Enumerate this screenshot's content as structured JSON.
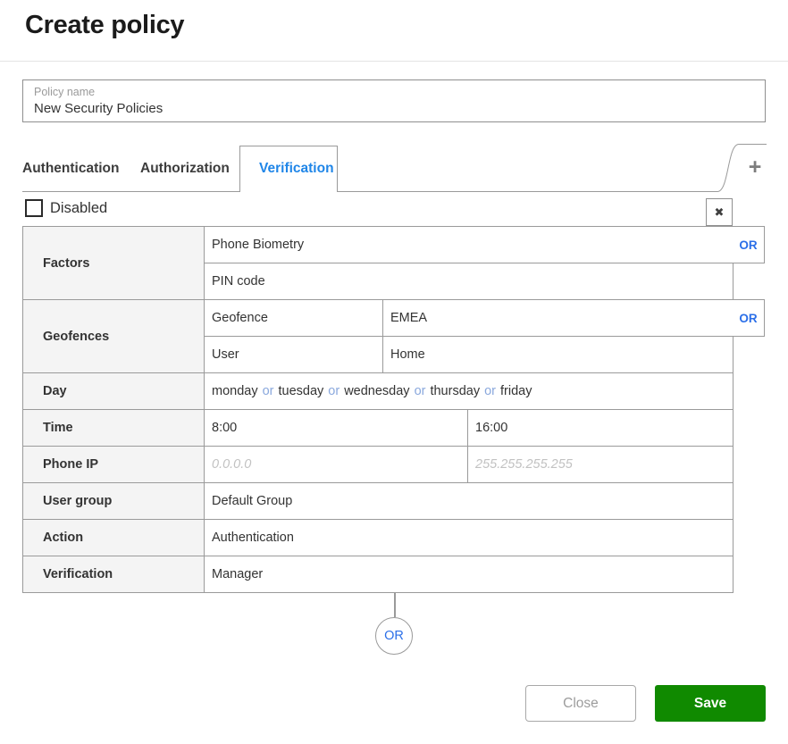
{
  "header": {
    "title": "Create policy"
  },
  "policy_name_field": {
    "label": "Policy name",
    "value": "New Security Policies"
  },
  "tabs": {
    "items": [
      {
        "label": "Authentication"
      },
      {
        "label": "Authorization"
      },
      {
        "label": "Verification"
      }
    ],
    "active": "Verification"
  },
  "icons": {
    "add_tab": "+",
    "close_section": "✖"
  },
  "section": {
    "disabled_label": "Disabled",
    "disabled_checked": false
  },
  "policy_table": {
    "factors": {
      "label": "Factors",
      "values": [
        "Phone Biometry",
        "PIN code"
      ],
      "connector": "OR"
    },
    "geofences": {
      "label": "Geofences",
      "rows": [
        {
          "type": "Geofence",
          "value": "EMEA"
        },
        {
          "type": "User",
          "value": "Home"
        }
      ],
      "connector": "OR"
    },
    "day": {
      "label": "Day",
      "days": [
        "monday",
        "tuesday",
        "wednesday",
        "thursday",
        "friday"
      ],
      "separator": "or"
    },
    "time": {
      "label": "Time",
      "from": "8:00",
      "to": "16:00"
    },
    "phone_ip": {
      "label": "Phone IP",
      "from_placeholder": "0.0.0.0",
      "to_placeholder": "255.255.255.255"
    },
    "user_group": {
      "label": "User group",
      "value": "Default Group"
    },
    "action": {
      "label": "Action",
      "value": "Authentication"
    },
    "verification": {
      "label": "Verification",
      "value": "Manager"
    }
  },
  "or_connector": {
    "label": "OR"
  },
  "footer": {
    "close_label": "Close",
    "save_label": "Save"
  },
  "colors": {
    "active_tab_blue": "#2086e8",
    "or_blue": "#2b6fe8",
    "day_separator_blue": "#8aa8dd",
    "save_green": "#108a00",
    "table_border": "#9a9a9a",
    "label_cell_bg": "#f4f4f4"
  }
}
